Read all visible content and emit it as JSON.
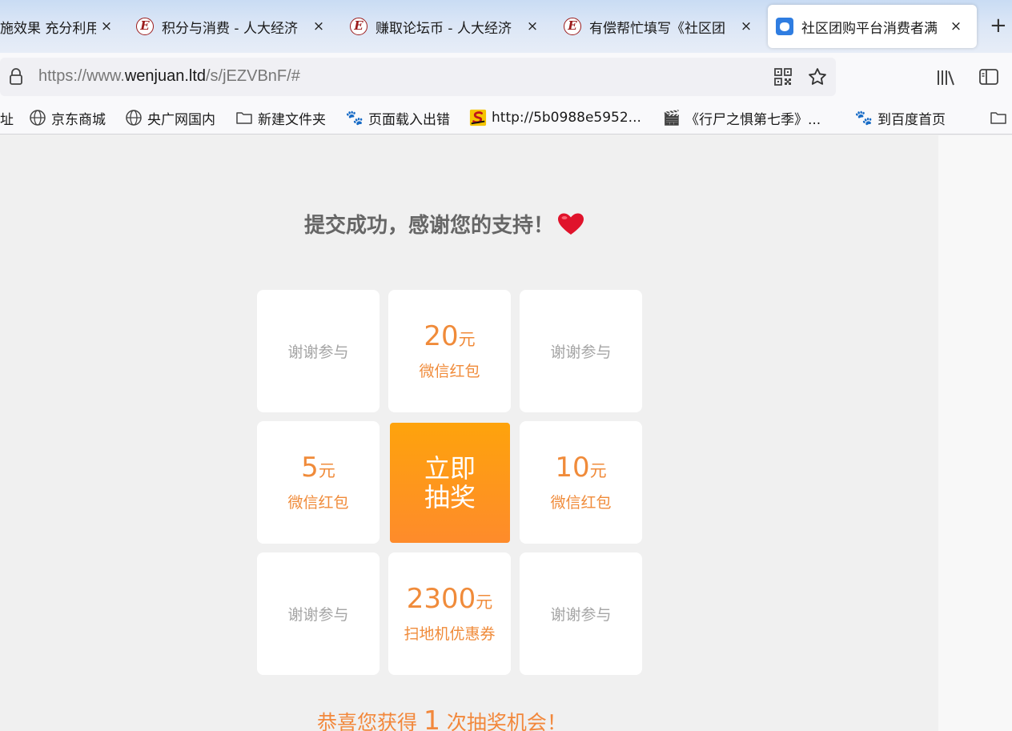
{
  "tabs": [
    {
      "title": "施效果 充分利用",
      "favicon": "none",
      "close": "×"
    },
    {
      "title": "积分与消费 - 人大经济",
      "favicon": "e-logo-icon",
      "close": "×"
    },
    {
      "title": "赚取论坛币 - 人大经济",
      "favicon": "e-logo-icon",
      "close": "×"
    },
    {
      "title": "有偿帮忙填写《社区团",
      "favicon": "e-logo-icon",
      "close": "×"
    },
    {
      "title": "社区团购平台消费者满",
      "favicon": "cat-logo-icon",
      "close": "×",
      "active": true
    }
  ],
  "newtab_label": "+",
  "favicon_e_letter": "E",
  "address": {
    "prefix": "https://www.",
    "host": "wenjuan.ltd",
    "path": "/s/jEZVBnF/#"
  },
  "bookmarks": [
    {
      "label": "址",
      "icon": "none"
    },
    {
      "label": "京东商城",
      "icon": "globe-icon"
    },
    {
      "label": "央广网国内",
      "icon": "globe-icon"
    },
    {
      "label": "新建文件夹",
      "icon": "folder-icon"
    },
    {
      "label": "页面载入出错",
      "icon": "baidu-paw-icon"
    },
    {
      "label": "http://5b0988e5952...",
      "icon": "s-logo-icon"
    },
    {
      "label": "《行尸之惧第七季》...",
      "icon": "clapperboard-icon"
    },
    {
      "label": "到百度首页",
      "icon": "baidu-paw-icon"
    }
  ],
  "page": {
    "success_text": "提交成功，感谢您的支持！",
    "lottery": {
      "prizes": [
        {
          "type": "none",
          "text": "谢谢参与"
        },
        {
          "type": "prize",
          "amount": "20",
          "unit": "元",
          "desc": "微信红包"
        },
        {
          "type": "none",
          "text": "谢谢参与"
        },
        {
          "type": "prize",
          "amount": "5",
          "unit": "元",
          "desc": "微信红包"
        },
        {
          "type": "prize",
          "amount": "10",
          "unit": "元",
          "desc": "微信红包"
        },
        {
          "type": "none",
          "text": "谢谢参与"
        },
        {
          "type": "prize",
          "amount": "2300",
          "unit": "元",
          "desc": "扫地机优惠券"
        },
        {
          "type": "none",
          "text": "谢谢参与"
        }
      ],
      "draw_button": {
        "line1": "立即",
        "line2": "抽奖"
      }
    },
    "congrats": {
      "before": "恭喜您获得 ",
      "count": "1",
      "after": " 次抽奖机会！"
    }
  },
  "colors": {
    "accent": "#f08b3a",
    "button_top": "#fea30c",
    "button_bottom": "#fe8b2b",
    "muted_text": "#a5a5a5",
    "heart": "#e0132b"
  }
}
